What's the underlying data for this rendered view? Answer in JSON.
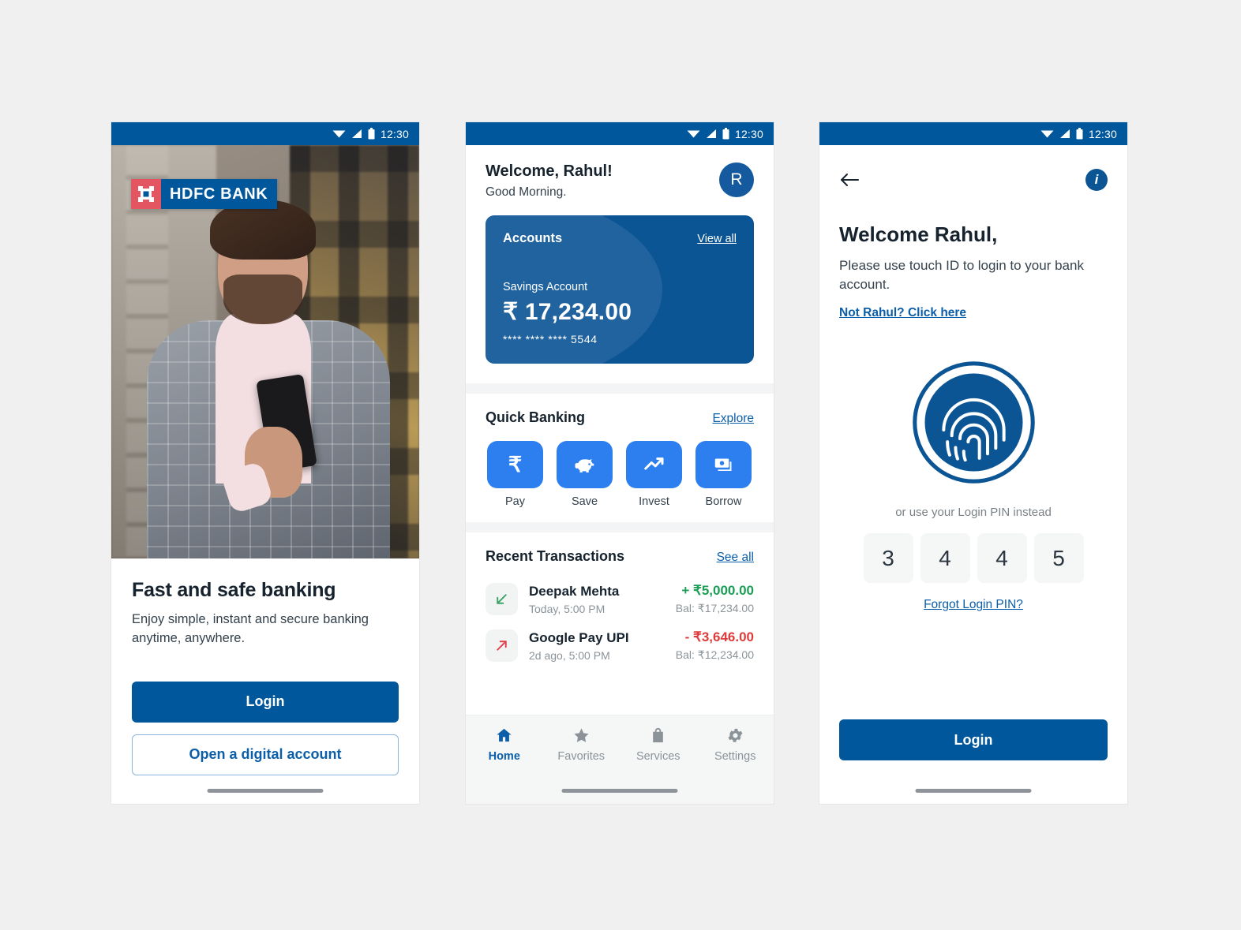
{
  "statusbar": {
    "time": "12:30",
    "icons": [
      "wifi-icon",
      "signal-icon",
      "battery-icon"
    ]
  },
  "colors": {
    "brand_blue": "#01579B",
    "card_blue": "#0b5595",
    "tile_blue": "#2D7FF0",
    "link_blue": "#0b5ea8",
    "credit_green": "#1b9e55",
    "debit_red": "#e03b3b",
    "logo_red": "#E35561",
    "page_bg": "#f0f0f0"
  },
  "onboarding": {
    "logo": {
      "bank_name": "HDFC BANK"
    },
    "title": "Fast and safe banking",
    "subtitle": "Enjoy simple, instant and secure banking anytime, anywhere.",
    "primary_button": "Login",
    "secondary_button": "Open a digital account"
  },
  "dashboard": {
    "welcome": "Welcome, Rahul!",
    "greeting": "Good Morning.",
    "avatar_initial": "R",
    "account_card": {
      "label": "Accounts",
      "view_all": "View all",
      "account_type": "Savings Account",
      "balance": "₹ 17,234.00",
      "masked_number": "**** **** **** 5544"
    },
    "quick_banking": {
      "title": "Quick Banking",
      "link": "Explore",
      "items": [
        {
          "label": "Pay",
          "icon": "rupee-icon"
        },
        {
          "label": "Save",
          "icon": "piggy-bank-icon"
        },
        {
          "label": "Invest",
          "icon": "trending-up-icon"
        },
        {
          "label": "Borrow",
          "icon": "banknotes-icon"
        }
      ]
    },
    "recent_transactions": {
      "title": "Recent Transactions",
      "link": "See all",
      "items": [
        {
          "name": "Deepak Mehta",
          "time": "Today, 5:00 PM",
          "amount": "+ ₹5,000.00",
          "balance": "Bal: ₹17,234.00",
          "direction": "credit",
          "icon": "arrow-down-left-icon"
        },
        {
          "name": "Google Pay UPI",
          "time": "2d ago, 5:00 PM",
          "amount": "- ₹3,646.00",
          "balance": "Bal: ₹12,234.00",
          "direction": "debit",
          "icon": "arrow-up-right-icon"
        }
      ]
    },
    "tabs": [
      {
        "label": "Home",
        "icon": "home-icon",
        "active": true
      },
      {
        "label": "Favorites",
        "icon": "star-icon",
        "active": false
      },
      {
        "label": "Services",
        "icon": "shopping-bag-icon",
        "active": false
      },
      {
        "label": "Settings",
        "icon": "gear-icon",
        "active": false
      }
    ]
  },
  "login": {
    "back_icon": "arrow-left-icon",
    "info_icon": "info-icon",
    "title": "Welcome Rahul,",
    "subtitle": "Please use touch ID to login to your bank account.",
    "not_you_link": "Not Rahul? Click here",
    "fingerprint_icon": "fingerprint-icon",
    "pin_hint": "or use your Login PIN instead",
    "pin_digits": [
      "3",
      "4",
      "4",
      "5"
    ],
    "forgot_link": "Forgot Login PIN?",
    "login_button": "Login"
  }
}
